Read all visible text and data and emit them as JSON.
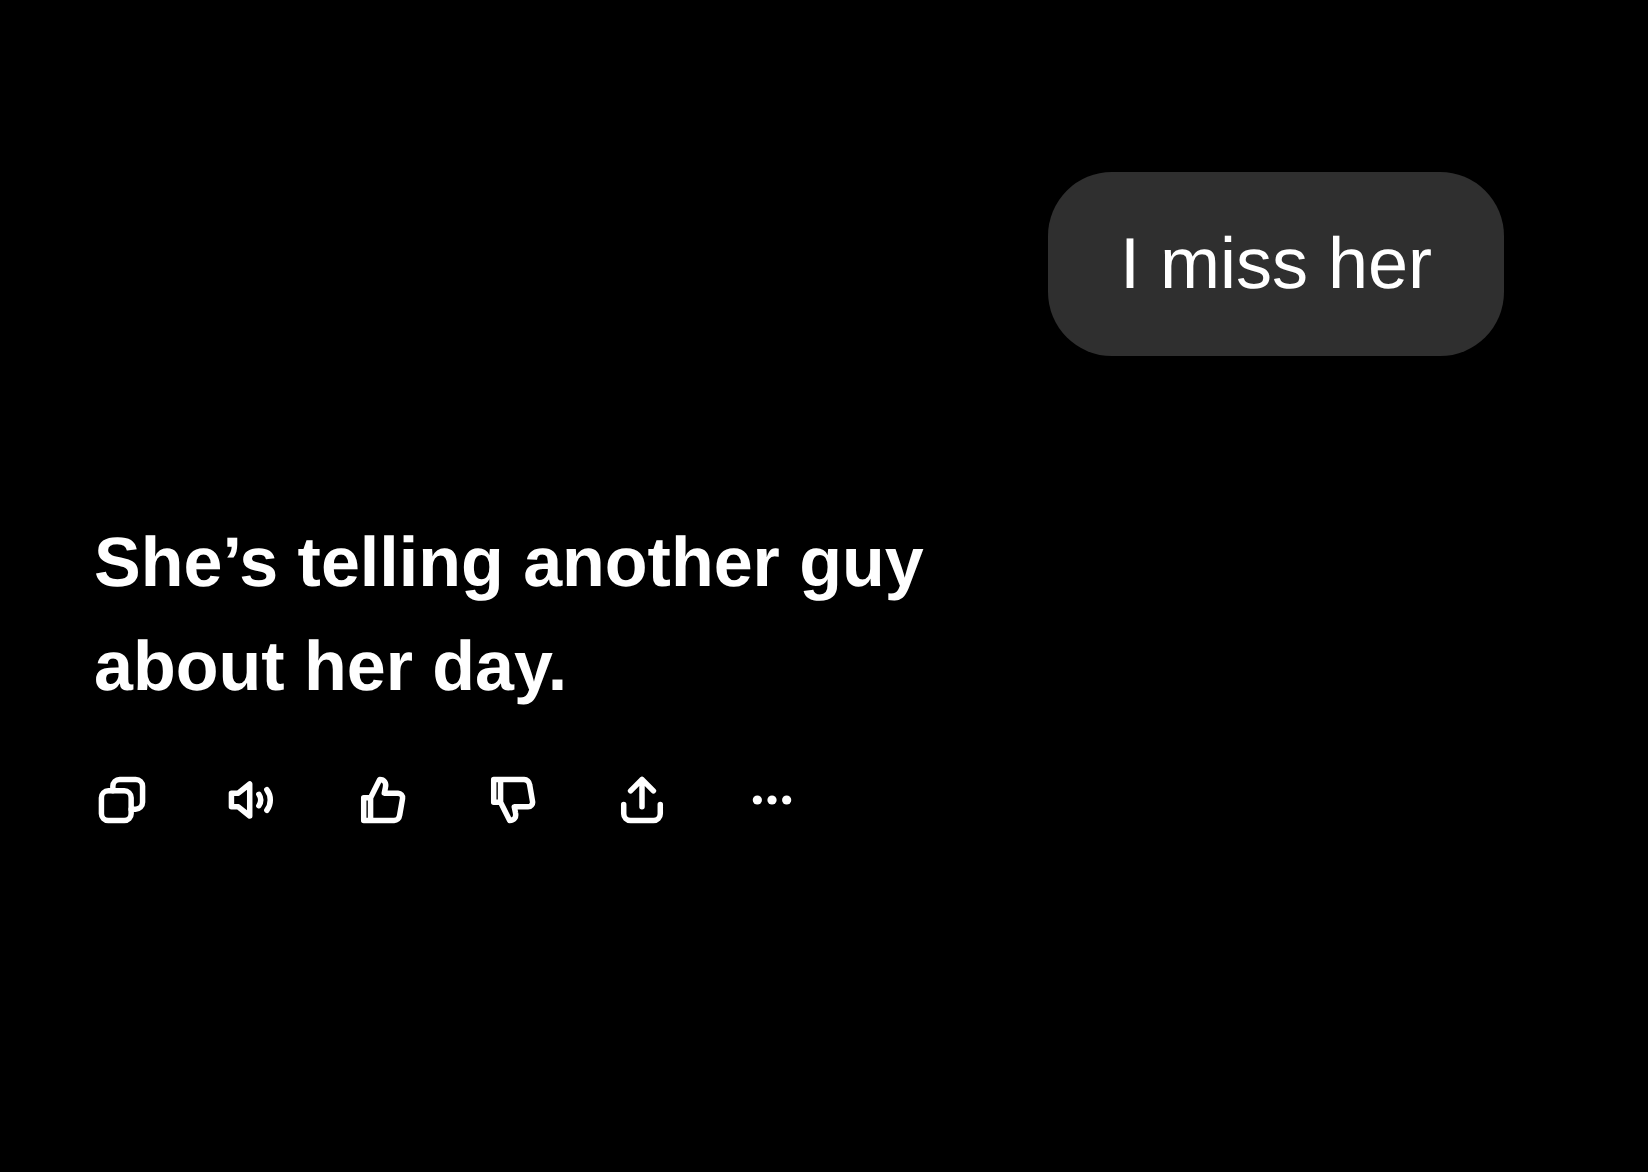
{
  "user_message": {
    "text": "I miss her"
  },
  "assistant_message": {
    "text": "She’s telling another guy about her day."
  },
  "actions": [
    {
      "kind": "copy"
    },
    {
      "kind": "speaker"
    },
    {
      "kind": "thumbs-up"
    },
    {
      "kind": "thumbs-down"
    },
    {
      "kind": "share"
    },
    {
      "kind": "more"
    }
  ]
}
